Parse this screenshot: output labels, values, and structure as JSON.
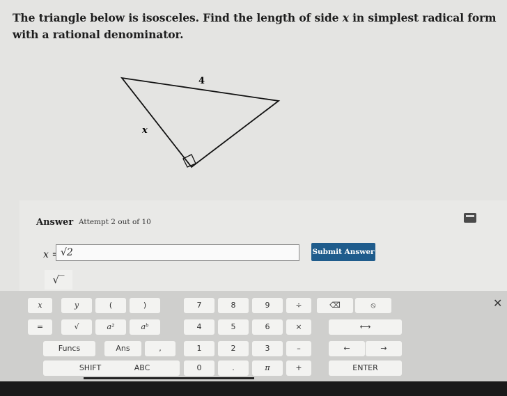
{
  "question": {
    "before": "The triangle below is isosceles. Find the length of side ",
    "var": "x",
    "after": " in simplest radical form with a rational denominator."
  },
  "figure": {
    "side_top": "4",
    "side_left": "x"
  },
  "answer": {
    "label": "Answer",
    "attempt": "Attempt 2 out of 10",
    "prefix": "x =",
    "input_value": "√2",
    "submit_label": "Submit Answer",
    "sqrt_button": "√‾"
  },
  "keyboard": {
    "rows": [
      [
        "x",
        "y",
        "(",
        ")",
        "7",
        "8",
        "9",
        "÷",
        "⌫",
        "⦸"
      ],
      [
        "=",
        "√",
        "a²",
        "aᵇ",
        "4",
        "5",
        "6",
        "×",
        "⟷"
      ],
      [
        "Funcs",
        "Ans",
        ",",
        "1",
        "2",
        "3",
        "–",
        "←",
        "→"
      ],
      [
        "SHIFT",
        "ABC",
        "0",
        ".",
        "π",
        "+",
        "ENTER"
      ]
    ],
    "close": "✕"
  },
  "colors": {
    "submit": "#1f5c8c",
    "keyboard_bg": "#cfcfcd"
  }
}
